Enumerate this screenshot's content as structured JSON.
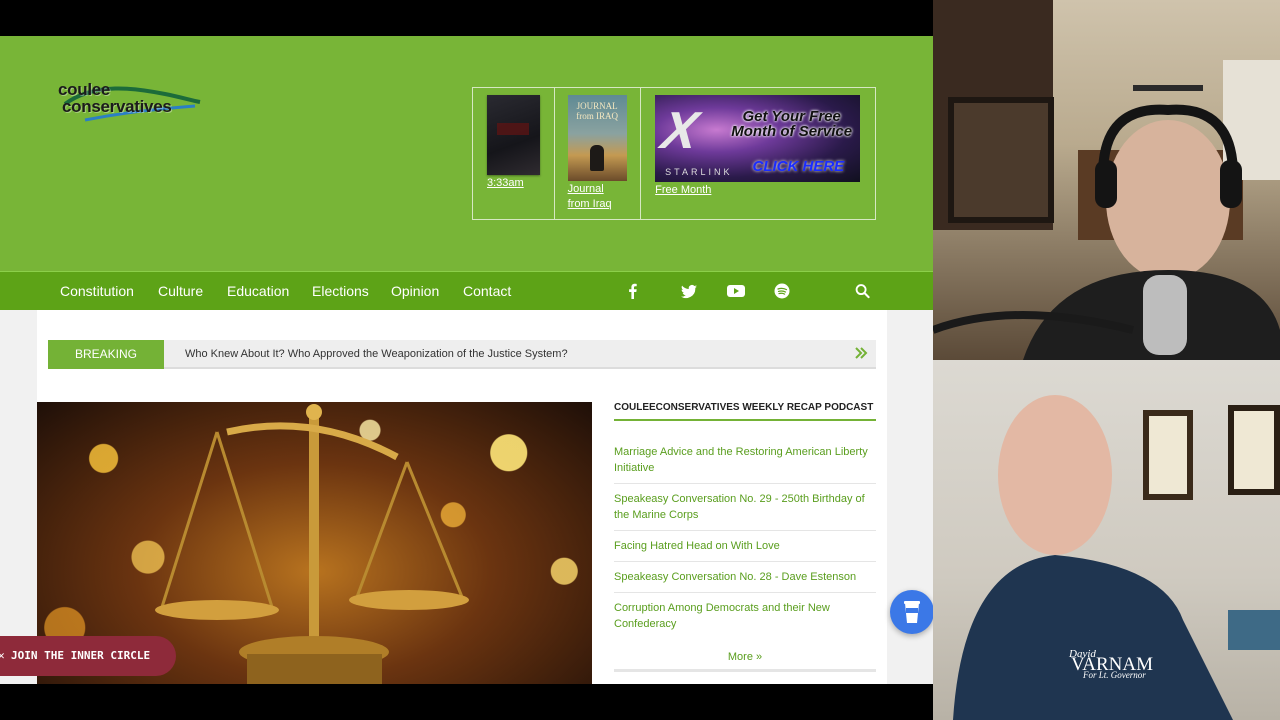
{
  "site": {
    "logo": {
      "line1": "coulee",
      "line2": "conservatives"
    },
    "ads": [
      {
        "link": "3:33am"
      },
      {
        "link": "Journal from Iraq",
        "cover_title": "JOURNAL from IRAQ"
      },
      {
        "link": "Free Month",
        "banner_line1": "Get Your Free Month of Service",
        "banner_cta": "CLICK HERE",
        "banner_brand": "STARLINK"
      }
    ],
    "nav": {
      "items": [
        "Constitution",
        "Culture",
        "Education",
        "Elections",
        "Opinion",
        "Contact"
      ],
      "social_icons": [
        "facebook-icon",
        "twitter-icon",
        "youtube-icon",
        "spotify-icon"
      ],
      "search_icon": "search-icon"
    },
    "breaking": {
      "label": "BREAKING",
      "headline": "Who Knew About It? Who Approved the Weaponization of the Justice System?"
    },
    "recap": {
      "heading": "COULEECONSERVATIVES WEEKLY RECAP PODCAST",
      "items": [
        "Marriage Advice and the Restoring American Liberty Initiative",
        "Speakeasy Conversation No. 29 - 250th Birthday of the Marine Corps",
        "Facing Hatred Head on With Love",
        "Speakeasy Conversation No. 28 - Dave Estenson",
        "Corruption Among Democrats and their New Confederacy"
      ],
      "more": "More »"
    },
    "inner_circle": "JOIN THE INNER CIRCLE",
    "colors": {
      "header": "#78b537",
      "nav": "#5da317",
      "accent": "#74b236",
      "link": "#5a9e1e"
    }
  },
  "cams": {
    "bottom_shirt_text_1": "David",
    "bottom_shirt_text_2": "VARNAM",
    "bottom_shirt_text_3": "For Lt. Governor"
  }
}
